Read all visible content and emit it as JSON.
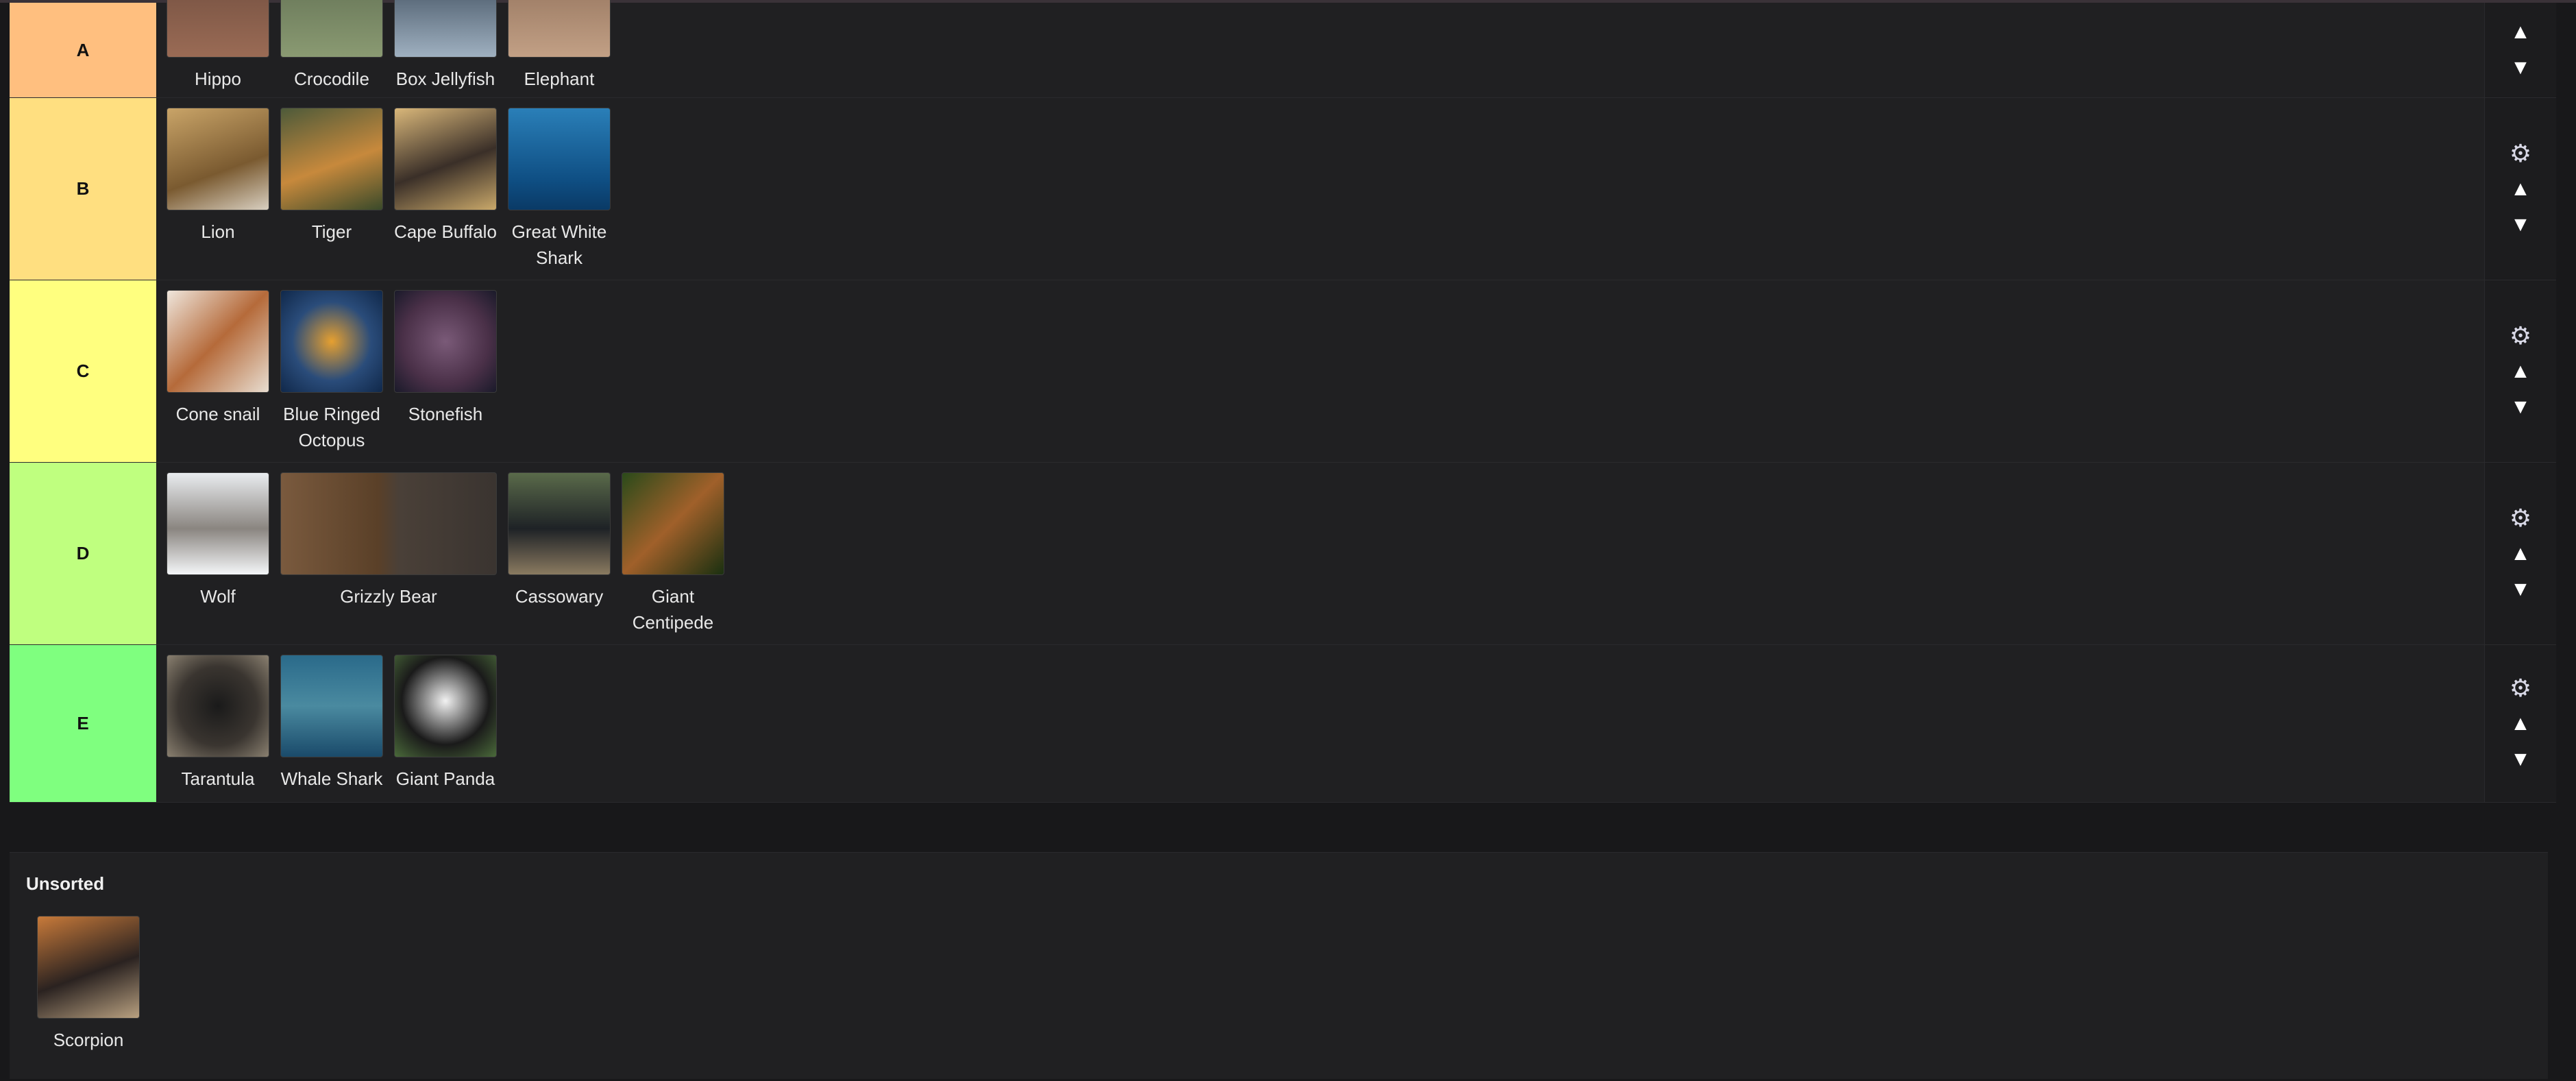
{
  "tiers": [
    {
      "label": "A",
      "color": "#ffbf7f",
      "show_gear": false,
      "items": [
        {
          "label": "Hippo",
          "thumb": "linear-gradient(180deg,#6b4a3c,#9a6b55)"
        },
        {
          "label": "Crocodile",
          "thumb": "linear-gradient(180deg,#5c6a4f,#8a9a72)"
        },
        {
          "label": "Box Jellyfish",
          "thumb": "linear-gradient(180deg,#2b3a4a,#9fb0c0)"
        },
        {
          "label": "Elephant",
          "thumb": "linear-gradient(180deg,#8a6a55,#c2a085)"
        }
      ]
    },
    {
      "label": "B",
      "color": "#ffdf80",
      "show_gear": true,
      "items": [
        {
          "label": "Lion",
          "thumb": "linear-gradient(160deg,#c9a468,#7a5a30 60%,#d8cfc0)"
        },
        {
          "label": "Tiger",
          "thumb": "linear-gradient(160deg,#4d5a3a,#c7893c 55%,#3a4a2a)"
        },
        {
          "label": "Cape Buffalo",
          "thumb": "linear-gradient(160deg,#d9b77a,#3a2f28 55%,#c9a86a)"
        },
        {
          "label": "Great White Shark",
          "thumb": "linear-gradient(180deg,#2a7fb8,#0f4f84 70%,#0a3a66)"
        }
      ]
    },
    {
      "label": "C",
      "color": "#ffff7f",
      "show_gear": true,
      "items": [
        {
          "label": "Cone snail",
          "thumb": "linear-gradient(135deg,#efe6dc,#b56a3a 50%,#e8ddd0)"
        },
        {
          "label": "Blue Ringed Octopus",
          "thumb": "radial-gradient(circle at 50% 50%,#e6a030,#2a4c7a 55%,#10284a)"
        },
        {
          "label": "Stonefish",
          "thumb": "radial-gradient(circle at 50% 50%,#7a5a78,#4a3048 60%,#1a1a2a)"
        }
      ]
    },
    {
      "label": "D",
      "color": "#bfff7f",
      "show_gear": true,
      "items": [
        {
          "label": "Wolf",
          "thumb": "linear-gradient(180deg,#e9ecef,#8a8580 55%,#f4f6f8)"
        },
        {
          "label": "Grizzly Bear",
          "thumb": "linear-gradient(90deg,#7a5a3e,#5a4028 45%,#4a4038 55%,#3a3430)",
          "wide": true
        },
        {
          "label": "Cassowary",
          "thumb": "linear-gradient(180deg,#5a6a4a,#1e2226 55%,#8a7a60)"
        },
        {
          "label": "Giant Centipede",
          "thumb": "linear-gradient(135deg,#2a4a1a,#a0602a 50%,#1a3010)"
        }
      ]
    },
    {
      "label": "E",
      "color": "#7fff7f",
      "show_gear": true,
      "items": [
        {
          "label": "Tarantula",
          "thumb": "radial-gradient(circle at 50% 50%,#1a1a1a,#3a3530 55%,#8a8070)"
        },
        {
          "label": "Whale Shark",
          "thumb": "linear-gradient(180deg,#2a6a8a,#4a8aa0 50%,#1a4a6a)"
        },
        {
          "label": "Giant Panda",
          "thumb": "radial-gradient(circle at 50% 45%,#f2f2f2,#1a1a1a 58%,#4a6a3a)"
        }
      ]
    }
  ],
  "controls": {
    "gear": "⚙",
    "up": "▲",
    "down": "▼"
  },
  "unsorted": {
    "title": "Unsorted",
    "items": [
      {
        "label": "Scorpion",
        "thumb": "linear-gradient(160deg,#c87a3a,#2a2220 55%,#b8a080)"
      }
    ]
  }
}
